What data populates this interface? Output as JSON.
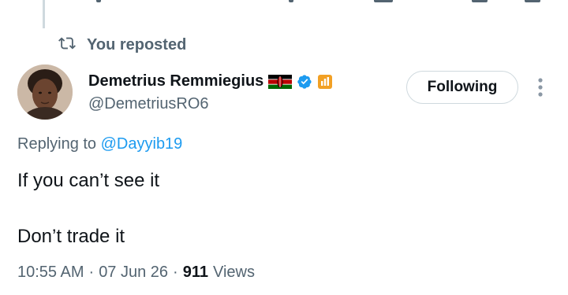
{
  "repost": {
    "label": "You reposted"
  },
  "author": {
    "display_name": "Demetrius Remmiegius",
    "handle": "@DemetriusRO6"
  },
  "follow_button": {
    "label": "Following"
  },
  "reply_context": {
    "prefix": "Replying to",
    "mention": "@Dayyib19"
  },
  "tweet": {
    "lines": [
      "If you can’t see it",
      "Don’t trade it"
    ]
  },
  "meta": {
    "time": "10:55 AM",
    "separator": "·",
    "date": "07 Jun 26",
    "views_count": "911",
    "views_label": "Views"
  },
  "colors": {
    "verified_blue": "#1d9bf0",
    "affiliate_orange": "#f2a024",
    "secondary_text": "#536471",
    "primary_text": "#0f1419"
  }
}
